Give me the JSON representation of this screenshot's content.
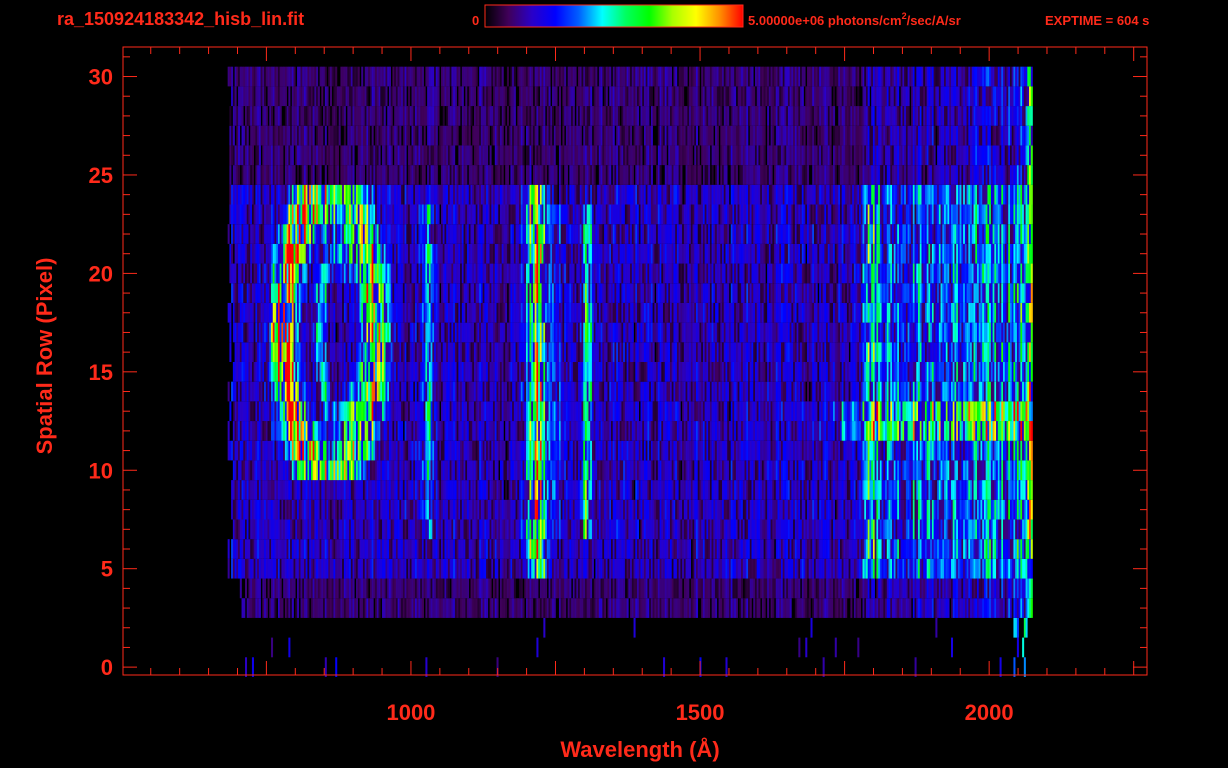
{
  "header": {
    "filename": "ra_150924183342_hisb_lin.fit",
    "colorbar_min_label": "0",
    "colorbar_max_label": "5.00000e+06 photons/cm",
    "colorbar_unit_sup": "2",
    "colorbar_unit_rest": "/sec/A/sr",
    "exptime": "EXPTIME = 604 s"
  },
  "colors": {
    "axis": "#ff2a1a",
    "background": "#000000",
    "colormap": [
      "#000000",
      "#40005a",
      "#2a00c8",
      "#0000ff",
      "#0060ff",
      "#00ffff",
      "#00ff60",
      "#00ff00",
      "#aaff00",
      "#ffff00",
      "#ff9000",
      "#ff0000"
    ]
  },
  "chart_data": {
    "type": "heatmap",
    "title": "ra_150924183342_hisb_lin.fit",
    "xlabel": "Wavelength (Å)",
    "ylabel": "Spatial Row (Pixel)",
    "xlim": [
      502,
      2273
    ],
    "ylim": [
      -0.4,
      31.5
    ],
    "x_ticks": [
      "1000",
      "1500",
      "2000"
    ],
    "x_tick_values": [
      1000,
      1500,
      2000
    ],
    "y_ticks": [
      "0",
      "5",
      "10",
      "15",
      "20",
      "25",
      "30"
    ],
    "y_tick_values": [
      0,
      5,
      10,
      15,
      20,
      25,
      30
    ],
    "colorbar": {
      "min": 0,
      "max": 5000000,
      "unit": "photons/cm^2/sec/A/sr"
    },
    "data_extent": {
      "wavelength": [
        680,
        2072
      ],
      "rows": [
        0,
        30
      ],
      "bin_angstrom": 3
    },
    "background_level": {
      "all_rows": 0.13,
      "rows_5_24": 0.22,
      "red_excess_above_1780": 0.18
    },
    "band": {
      "rows": [
        12,
        13
      ],
      "start": 1700,
      "amplitude": 0.3
    },
    "emission_lines": [
      {
        "wavelength": 1216,
        "rows": [
          5,
          24
        ],
        "amplitude": 0.62,
        "sigma": 11
      },
      {
        "wavelength": 1026,
        "rows": [
          7,
          23
        ],
        "amplitude": 0.3,
        "sigma": 6
      },
      {
        "wavelength": 1304,
        "rows": [
          7,
          23
        ],
        "amplitude": 0.3,
        "sigma": 7
      },
      {
        "wavelength": 1255,
        "rows": [
          7,
          23
        ],
        "amplitude": 0.12,
        "sigma": 12
      },
      {
        "wavelength": 1790,
        "rows": [
          5,
          24
        ],
        "amplitude": 0.18,
        "sigma": 15
      },
      {
        "wavelength": 2068,
        "rows": [
          3,
          30
        ],
        "amplitude": 0.5,
        "sigma": 3
      }
    ],
    "arcs": [
      {
        "center_wavelength": 860,
        "center_row": 17,
        "radius_wavelength": 82,
        "radius_rows": 7,
        "amplitude": 0.55,
        "left_boost": 0.4
      },
      {
        "center_wavelength": 880,
        "center_row": 17,
        "radius_wavelength": 42,
        "radius_rows": 4,
        "amplitude": 0.3,
        "left_boost": 0
      }
    ]
  }
}
